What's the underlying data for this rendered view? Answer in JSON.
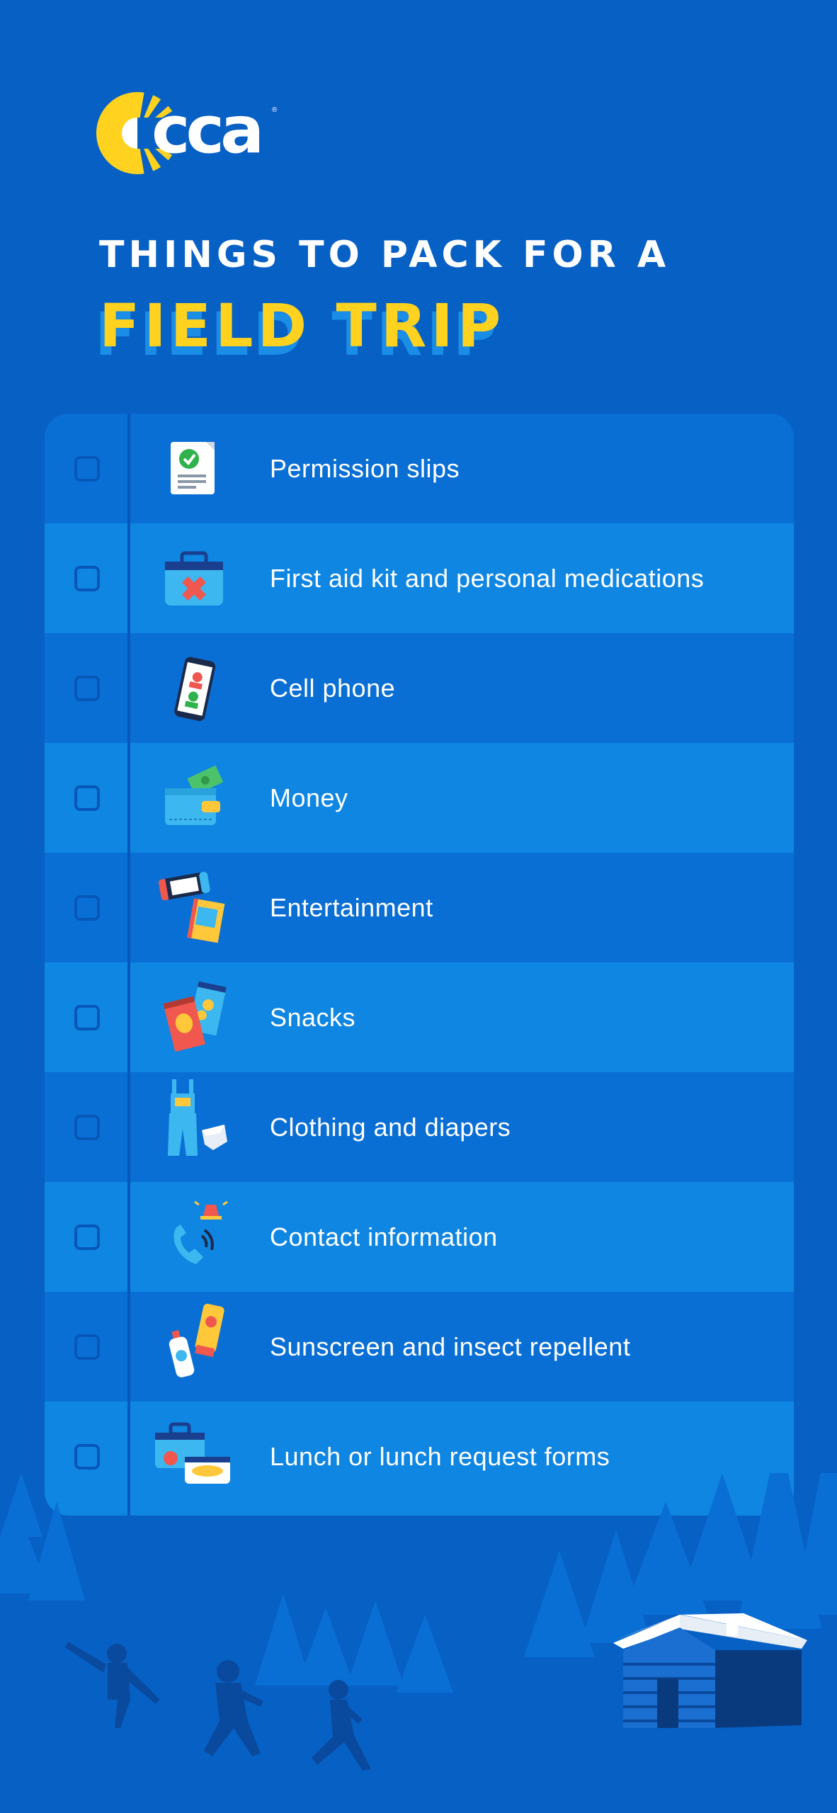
{
  "brand": {
    "logo_text": "cca",
    "logo_mark": "®"
  },
  "header": {
    "subtitle": "THINGS TO PACK FOR A",
    "title": "FIELD TRIP"
  },
  "checklist": {
    "items": [
      {
        "label": "Permission slips",
        "icon": "permission-slip-icon",
        "checked": false
      },
      {
        "label": "First aid kit and personal medications",
        "icon": "first-aid-kit-icon",
        "checked": false
      },
      {
        "label": "Cell phone",
        "icon": "cell-phone-icon",
        "checked": false
      },
      {
        "label": "Money",
        "icon": "wallet-money-icon",
        "checked": false
      },
      {
        "label": "Entertainment",
        "icon": "game-console-book-icon",
        "checked": false
      },
      {
        "label": "Snacks",
        "icon": "snack-bags-icon",
        "checked": false
      },
      {
        "label": "Clothing and diapers",
        "icon": "overalls-diaper-icon",
        "checked": false
      },
      {
        "label": "Contact information",
        "icon": "phone-alarm-icon",
        "checked": false
      },
      {
        "label": "Sunscreen and insect repellent",
        "icon": "sunscreen-bottles-icon",
        "checked": false
      },
      {
        "label": "Lunch or lunch request forms",
        "icon": "lunchbox-icon",
        "checked": false
      }
    ]
  },
  "colors": {
    "background": "#0760c4",
    "row_dark": "#0a6fd4",
    "row_light": "#0f86e2",
    "title_accent": "#ffd21f",
    "text": "#ffffff"
  }
}
